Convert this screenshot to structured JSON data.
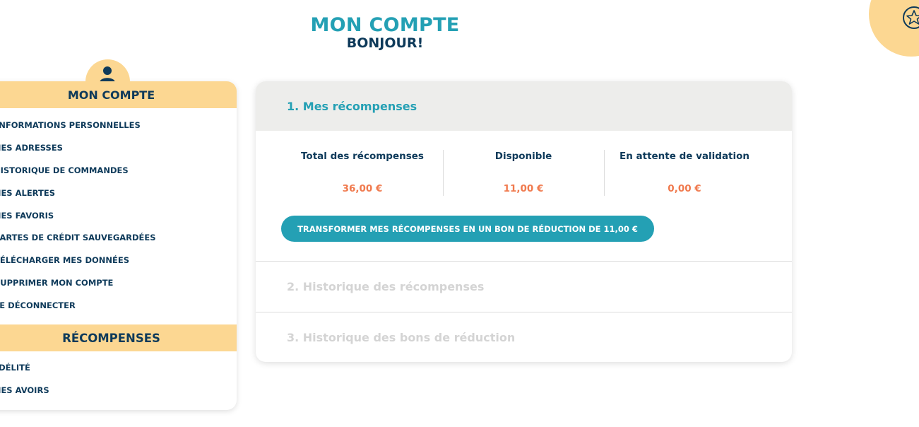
{
  "header": {
    "title": "MON COMPTE",
    "subtitle": "BONJOUR!"
  },
  "sidebar": {
    "account_heading": "MON COMPTE",
    "account_items": [
      {
        "label": "INFORMATIONS PERSONNELLES"
      },
      {
        "label": "MES ADRESSES"
      },
      {
        "label": "HISTORIQUE DE COMMANDES"
      },
      {
        "label": "MES ALERTES"
      },
      {
        "label": "MES FAVORIS"
      },
      {
        "label": "CARTES DE CRÉDIT SAUVEGARDÉES"
      },
      {
        "label": "TÉLÉCHARGER MES DONNÉES"
      },
      {
        "label": "SUPPRIMER MON COMPTE"
      },
      {
        "label": "SE DÉCONNECTER"
      }
    ],
    "rewards_heading": "RÉCOMPENSES",
    "rewards_items": [
      {
        "label": "FIDÉLITÉ"
      },
      {
        "label": "MES AVOIRS"
      }
    ],
    "icons": {
      "avatar": "user-icon",
      "corner": "star-badge-icon"
    }
  },
  "main": {
    "sections": [
      {
        "title": "1. Mes récompenses"
      },
      {
        "title": "2. Historique des récompenses"
      },
      {
        "title": "3. Historique des bons de réduction"
      }
    ],
    "stats": [
      {
        "label": "Total des récompenses",
        "value": "36,00 €"
      },
      {
        "label": "Disponible",
        "value": "11,00 €"
      },
      {
        "label": "En attente de validation",
        "value": "0,00 €"
      }
    ],
    "cta_label": "TRANSFORMER MES RÉCOMPENSES EN UN BON DE RÉDUCTION DE 11,00 €"
  },
  "colors": {
    "accent_teal": "#24a0b4",
    "navy": "#0e3a5a",
    "yellow": "#fcd792",
    "orange_value": "#f07a4e",
    "muted": "#d4d4d4"
  }
}
